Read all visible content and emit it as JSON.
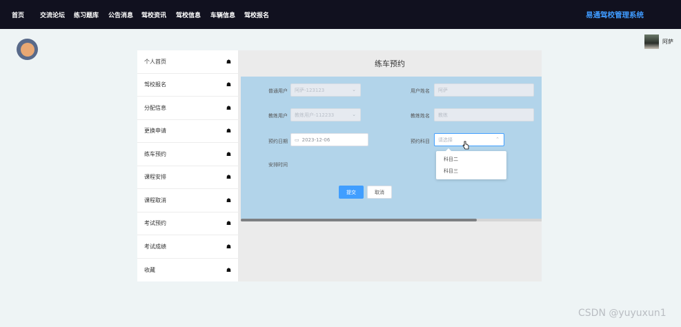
{
  "nav": {
    "items": [
      "首页",
      "交流论坛",
      "练习题库",
      "公告消息",
      "驾校资讯",
      "驾校信息",
      "车辆信息",
      "驾校报名"
    ],
    "brand": "易通驾校管理系统"
  },
  "user": {
    "name": "阿萨"
  },
  "sidemenu": {
    "items": [
      {
        "label": "个人首页",
        "icon": "home-icon"
      },
      {
        "label": "驾校报名",
        "icon": "home-icon"
      },
      {
        "label": "分配信息",
        "icon": "home-icon"
      },
      {
        "label": "更换申请",
        "icon": "home-icon"
      },
      {
        "label": "练车预约",
        "icon": "home-icon"
      },
      {
        "label": "课程安排",
        "icon": "home-icon"
      },
      {
        "label": "课程取消",
        "icon": "home-icon"
      },
      {
        "label": "考试预约",
        "icon": "home-icon"
      },
      {
        "label": "考试成绩",
        "icon": "home-icon"
      },
      {
        "label": "收藏",
        "icon": "home-icon"
      }
    ]
  },
  "panel": {
    "title": "练车预约",
    "form": {
      "account_label": "普通用户",
      "account_value": "阿萨-123123",
      "user_name_label": "用户姓名",
      "user_name_value": "阿萨",
      "coach_account_label": "教练用户",
      "coach_account_value": "教练用户-112233",
      "coach_name_label": "教练姓名",
      "coach_name_value": "教练",
      "date_label": "预约日期",
      "date_value": "2023-12-06",
      "subject_label": "预约科目",
      "subject_placeholder": "请选择",
      "subject_options": [
        "科目二",
        "科目三"
      ],
      "time_label": "安排时间",
      "submit_label": "提交",
      "cancel_label": "取消"
    }
  },
  "watermark": "CSDN @yuyuxun1",
  "colors": {
    "topbar": "#11111f",
    "brand": "#3f9bff",
    "form_bg": "#b2d4ea",
    "primary": "#409eff"
  }
}
